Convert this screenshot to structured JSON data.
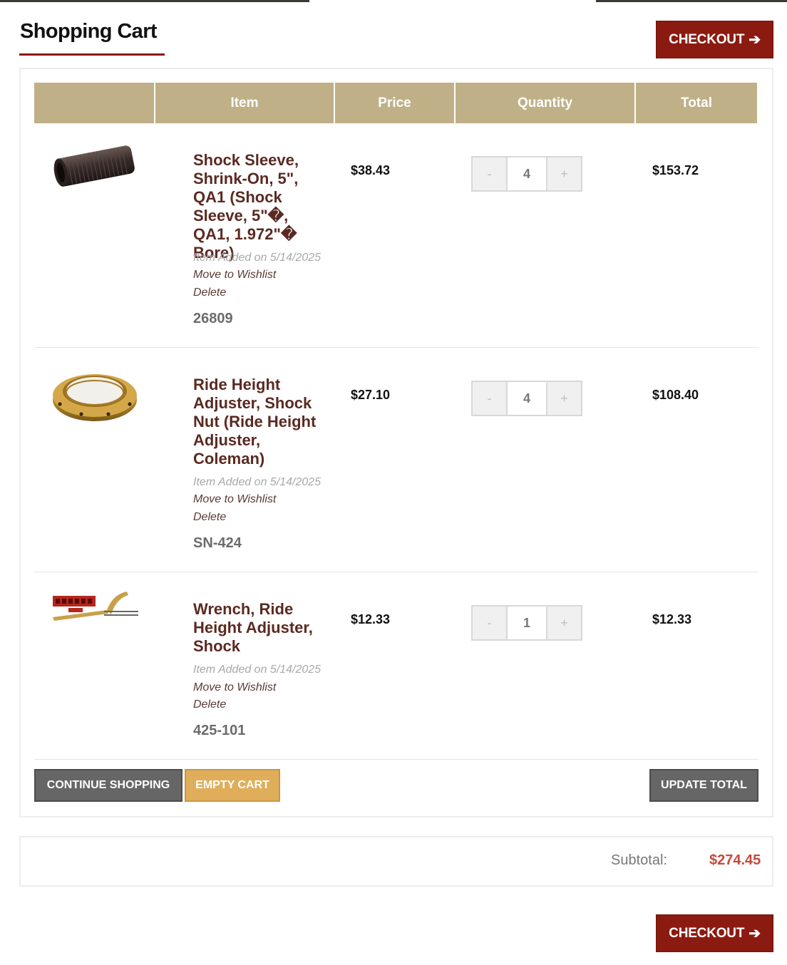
{
  "header": {
    "title": "Shopping Cart",
    "checkout_label": "CHECKOUT"
  },
  "table": {
    "columns": [
      "",
      "Item",
      "Price",
      "Quantity",
      "Total"
    ]
  },
  "items": [
    {
      "name": "Shock Sleeve, Shrink-On, 5\", QA1 (Shock Sleeve, 5\"�, QA1, 1.972\"� Bore)",
      "added": "Item Added on 5/14/2025",
      "wishlist": "Move to Wishlist",
      "delete": "Delete",
      "sku": "26809",
      "price": "$38.43",
      "qty_minus": "-",
      "quantity": "4",
      "qty_plus": "+",
      "total": "$153.72",
      "image_icon": "shock-sleeve-icon"
    },
    {
      "name": "Ride Height Adjuster, Shock Nut (Ride Height Adjuster, Coleman)",
      "added": "Item Added on 5/14/2025",
      "wishlist": "Move to Wishlist",
      "delete": "Delete",
      "sku": "SN-424",
      "price": "$27.10",
      "qty_minus": "-",
      "quantity": "4",
      "qty_plus": "+",
      "total": "$108.40",
      "image_icon": "shock-nut-icon"
    },
    {
      "name": "Wrench, Ride Height Adjuster, Shock",
      "added": "Item Added on 5/14/2025",
      "wishlist": "Move to Wishlist",
      "delete": "Delete",
      "sku": "425-101",
      "price": "$12.33",
      "qty_minus": "-",
      "quantity": "1",
      "qty_plus": "+",
      "total": "$12.33",
      "image_icon": "spanner-wrench-icon"
    }
  ],
  "actions": {
    "continue_label": "CONTINUE SHOPPING",
    "empty_label": "EMPTY CART",
    "update_label": "UPDATE TOTAL"
  },
  "summary": {
    "subtotal_label": "Subtotal:",
    "subtotal_value": "$274.45"
  },
  "colors": {
    "brand_red": "#8b1a10",
    "header_tan": "#bfb087",
    "empty_gold": "#e0ae5b",
    "subtotal_red": "#c6493a"
  }
}
